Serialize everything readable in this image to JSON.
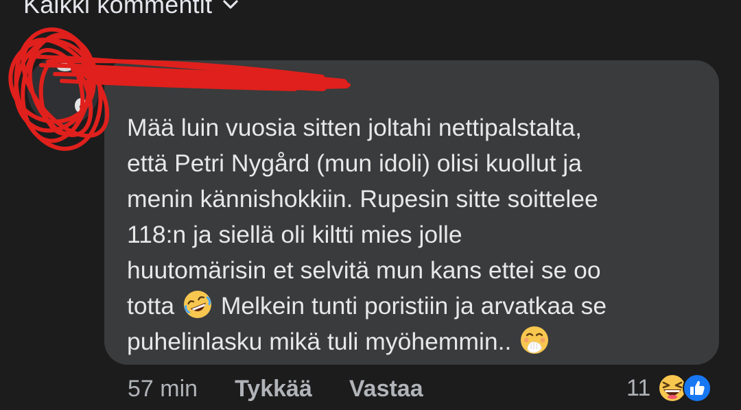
{
  "comments_filter": {
    "label": "Kaikki kommentit",
    "icon": "chevron-down-icon"
  },
  "comment": {
    "author": "",
    "text_before_emoji_1": "Mää luin vuosia sitten joltahi nettipalstalta,\nettä Petri Nygård (mun idoli) olisi kuollut ja\nmenin kännishokkiin. Rupesin sitte soittelee\n118:n ja siellä oli kiltti mies jolle\nhuutomärisin et selvitä mun kans ettei se oo\ntotta ",
    "emoji_1": "rolling-on-floor-laughing-emoji",
    "text_between": " Melkein tunti poristiin ja arvatkaa se\npuhelinlasku mikä tuli myöhemmin.. ",
    "emoji_2": "face-with-hand-over-mouth-emoji",
    "time": "57 min",
    "like_label": "Tykkää",
    "reply_label": "Vastaa",
    "reaction_count": "11",
    "reactions": [
      "haha-reaction-icon",
      "like-reaction-icon"
    ]
  },
  "colors": {
    "background": "#1c1c1d",
    "bubble": "#3a3b3c",
    "text": "#e8e8e9",
    "secondary_text": "#b0b3b8",
    "like_blue": "#1877f2",
    "emoji_yellow": "#f7c74f",
    "scribble_red": "#e0201c"
  }
}
